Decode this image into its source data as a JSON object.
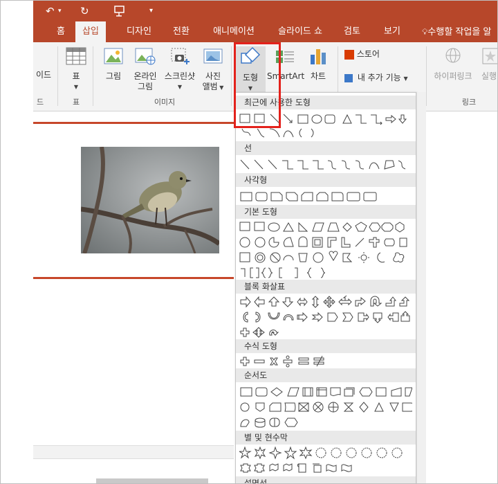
{
  "qat": {
    "undo": "↶",
    "redo": "↻",
    "more": "▾"
  },
  "tabs": [
    "홈",
    "삽입",
    "디자인",
    "전환",
    "애니메이션",
    "슬라이드 쇼",
    "검토",
    "보기"
  ],
  "tell_me": "수행할 작업을 알",
  "ribbon": {
    "partial_left": "이드",
    "partial_left_group": "드",
    "table": {
      "label": "표",
      "group": "표"
    },
    "picture": "그림",
    "online_picture_1": "온라인",
    "online_picture_2": "그림",
    "screenshot": "스크린샷",
    "photo_album_1": "사진",
    "photo_album_2": "앨범",
    "images_group": "이미지",
    "shapes": "도형",
    "smartart": "SmartArt",
    "chart": "차트",
    "store": "스토어",
    "my_addins": "내 추가 기능",
    "hyperlink": "하이퍼링크",
    "action": "실행",
    "links_group": "링크"
  },
  "dropdown": {
    "recent": "최근에 사용한 도형",
    "lines": "선",
    "rectangles": "사각형",
    "basic": "기본 도형",
    "block_arrows": "블록 화살표",
    "equation": "수식 도형",
    "flowchart": "순서도",
    "stars": "별 및 현수막",
    "callouts": "설명선"
  },
  "colors": {
    "accent": "#b7472a",
    "highlight": "#e3211b"
  }
}
